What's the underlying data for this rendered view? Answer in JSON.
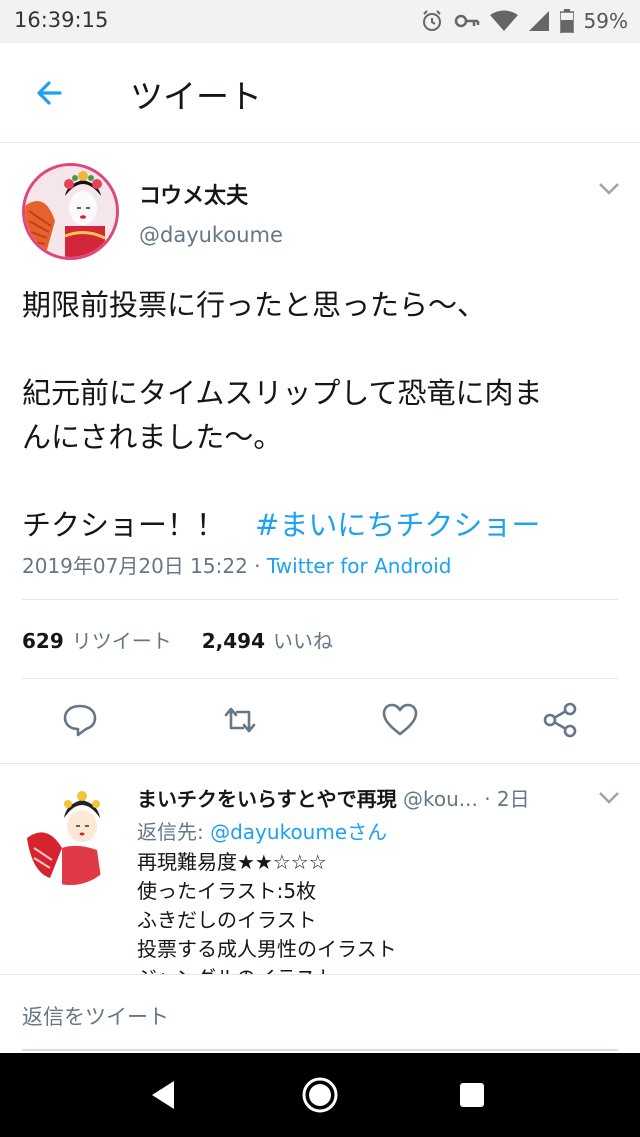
{
  "status_bar": {
    "time": "16:39:15",
    "battery": "59%",
    "icons": [
      "alarm-icon",
      "vpn-key-icon",
      "wifi-icon",
      "signal-icon",
      "battery-icon"
    ]
  },
  "header": {
    "title": "ツイート",
    "back_icon": "back-arrow-icon"
  },
  "tweet": {
    "author_name": "コウメ太夫",
    "author_handle": "@dayukoume",
    "lines": [
      "期限前投票に行ったと思ったら〜、",
      "紀元前にタイムスリップして恐竜に肉ま",
      "んにされました〜。",
      "チクショー！！"
    ],
    "hashtag": "#まいにちチクショー",
    "date": "2019年07月20日 15:22",
    "separator": " · ",
    "via": "Twitter for Android",
    "retweets_count": "629",
    "retweets_label": "リツイート",
    "likes_count": "2,494",
    "likes_label": "いいね"
  },
  "actions": [
    "reply-icon",
    "retweet-icon",
    "like-icon",
    "share-icon"
  ],
  "reply": {
    "name": "まいチクをいらすとやで再現",
    "handle": "@kou...",
    "time": "· 2日",
    "reply_to_label": "返信先: ",
    "reply_to_mention": "@dayukoumeさん",
    "lines": [
      "再現難易度★★☆☆☆",
      "使ったイラスト:5枚",
      "ふきだしのイラスト",
      "投票する成人男性のイラスト",
      "ジャングルのイラスト"
    ]
  },
  "compose": {
    "placeholder": "返信をツイート"
  },
  "nav": [
    "back-triangle-icon",
    "home-circle-icon",
    "recents-square-icon"
  ],
  "colors": {
    "accent": "#1da1f2",
    "secondary_text": "#657786",
    "divider": "#e1e8ed"
  }
}
